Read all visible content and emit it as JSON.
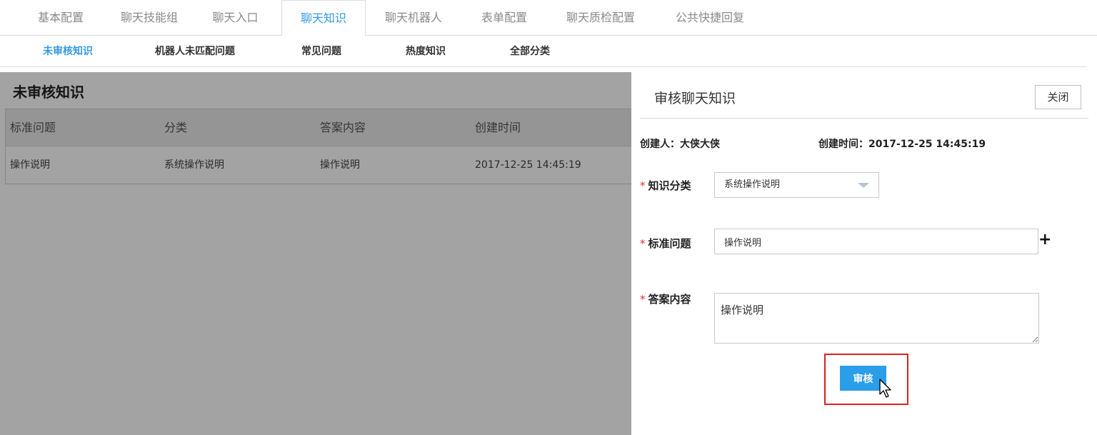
{
  "top_tabs": [
    "基本配置",
    "聊天技能组",
    "聊天入口",
    "聊天知识",
    "聊天机器人",
    "表单配置",
    "聊天质检配置",
    "公共快捷回复"
  ],
  "active_top_tab": "聊天知识",
  "sub_tabs": [
    "未审核知识",
    "机器人未匹配问题",
    "常见问题",
    "热度知识",
    "全部分类"
  ],
  "active_sub_tab": "未审核知识",
  "page_title": "未审核知识",
  "table": {
    "headers": [
      "标准问题",
      "分类",
      "答案内容",
      "创建时间"
    ],
    "rows": [
      [
        "操作说明",
        "系统操作说明",
        "操作说明",
        "2017-12-25 14:45:19"
      ]
    ]
  },
  "drawer": {
    "title": "审核聊天知识",
    "close_label": "关闭",
    "creator_label": "创建人：",
    "creator_value": "大侠大侠",
    "created_time_label": "创建时间：",
    "created_time_value": "2017-12-25 14:45:19",
    "required_mark": "*",
    "category_label": "知识分类",
    "category_value": "系统操作说明",
    "question_label": "标准问题",
    "question_value": "操作说明",
    "add_symbol": "+",
    "answer_label": "答案内容",
    "answer_value": "操作说明",
    "approve_label": "审核"
  },
  "icons": {
    "dropdown": "chevron-down-icon",
    "add": "plus-icon",
    "cursor": "mouse-pointer-icon"
  },
  "colors": {
    "accent": "#3399e6",
    "button": "#2a9ee8",
    "required": "#e0303a",
    "highlight": "#e02020"
  }
}
